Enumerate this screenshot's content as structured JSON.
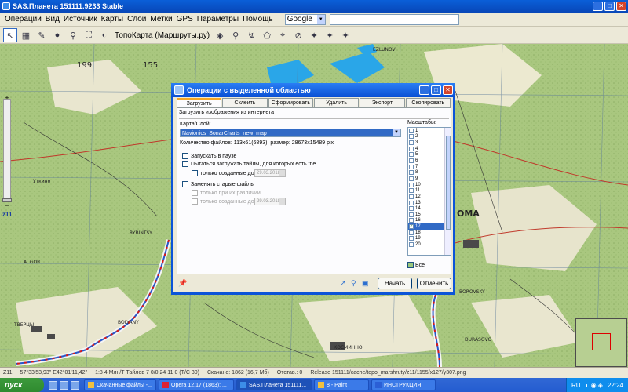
{
  "window": {
    "title": "SAS.Планета 151111.9233 Stable"
  },
  "menu": [
    "Операции",
    "Вид",
    "Источник",
    "Карты",
    "Слои",
    "Метки",
    "GPS",
    "Параметры",
    "Помощь"
  ],
  "search_combo": {
    "value": "Google"
  },
  "toolbar": {
    "map_label": "ТопоКарта (Маршруты.ру)"
  },
  "zoom_level": "z11",
  "map_labels": {
    "n1": "199",
    "n2": "155",
    "rybinsk": "RYBINTSY",
    "agor": "A. GOR",
    "tver": "ТВЕРЦЫ",
    "bolyany": "BOLYANY",
    "koma": "ОМА",
    "borovsky": "BOROVSKY",
    "durasovo": "DURASOVO",
    "kosmin": "КОСМИННО",
    "ezlun": "EZLUNOV",
    "utkino": "Уткино"
  },
  "dialog": {
    "title": "Операции с выделенной областью",
    "tabs": [
      "Загрузить",
      "Склеить",
      "Сформировать",
      "Удалить",
      "Экспорт",
      "Скопировать"
    ],
    "header": "Загрузить изображения из интернета",
    "map_layer_label": "Карта/Слой:",
    "layer_value": "Navionics_SonarCharts_new_map",
    "file_count": "Количество файлов: 113x61(6893), размер: 28673x15489 pix",
    "scales_label": "Масштабы:",
    "scales": [
      "1",
      "2",
      "3",
      "4",
      "5",
      "6",
      "7",
      "8",
      "9",
      "10",
      "11",
      "12",
      "13",
      "14",
      "15",
      "16",
      "17",
      "18",
      "19",
      "20"
    ],
    "scales_selected": "17",
    "scales_checked": [
      "17"
    ],
    "checkboxes": {
      "start_paused": "Запускать в паузе",
      "try_load_tne": "Пытаться загружать тайлы, для которых есть tne",
      "only_created_before": "только созданные до",
      "replace_old": "Заменять старые файлы",
      "only_if_diff": "только при их различии",
      "only_created_before2": "только созданные до"
    },
    "date1": "29.03.2018",
    "date2": "29.03.2018",
    "all_label": "Все",
    "start_button": "Начать",
    "cancel_button": "Отменить"
  },
  "statusbar": [
    "Z11",
    "57°33'53,93\" E42°01'11,42\"",
    "1:8 4 Млн/Т Тайлов 7 0/0 24 11 0 (T/C 30)",
    "Скачано: 1862 (16,7 Мб)",
    "Отстав.: 0",
    "Release 151111/cache/topo_marshruty/z11/1155/x127/y307.png"
  ],
  "taskbar": {
    "start": "пуск",
    "tasks": [
      "Скачанные файлы -...",
      "Opera 12.17 (1863): ...",
      "SAS.Планета 151111...",
      "8 - Paint",
      "ИНСТРУКЦИЯ"
    ],
    "lang": "RU",
    "clock": "22:24"
  }
}
